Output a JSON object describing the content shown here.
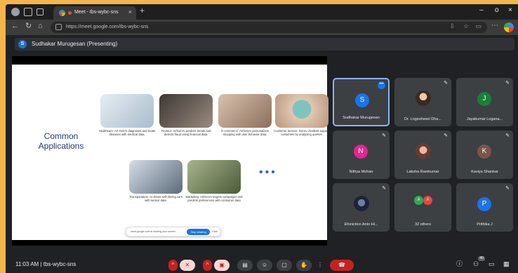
{
  "browser": {
    "tab_title": "Meet - tbs-wybc-sns",
    "url": "https://meet.google.com/tbs-wybc-sns",
    "tab_close": "×",
    "new_tab": "+",
    "minimize": "–",
    "maximize": "o",
    "close": "×"
  },
  "presenter": {
    "initial": "S",
    "label": "Sudhakar Murugesan (Presenting)"
  },
  "slide": {
    "title": "Common Applications",
    "cards": [
      {
        "id": "healthcare",
        "text": "Healthcare: AI/ GenAI diagnoses and treats diseases with medical data.",
        "color": "#c9d6e2"
      },
      {
        "id": "finance",
        "text": "Finance: AI/GenAI predicts trends and detects fraud using financial data.",
        "color": "#6f625a"
      },
      {
        "id": "ecommerce",
        "text": "E-commerce: AI/GenAI personalizes shopping with user behavior data.",
        "color": "#b89c86"
      },
      {
        "id": "customer-service",
        "text": "Customer Service: GenAI chatbots support customers by analyzing queries.",
        "color": "#8fb0b2"
      },
      {
        "id": "transportation",
        "text": "Transportation: AI drives self-driving cars with sensor data.",
        "color": "#8a98a8"
      },
      {
        "id": "marketing",
        "text": "Marketing: AI/GenAI targets campaigns and predicts preferences with consumer data",
        "color": "#76855f"
      }
    ],
    "more": "•••",
    "share_banner": {
      "text": "meet.google.com is sharing your screen.",
      "stop_label": "Stop sharing",
      "hide_label": "Hide"
    }
  },
  "participants": [
    {
      "name": "Sudhakar Murugesan",
      "initial": "S",
      "color": "#1a73e8",
      "kind": "avatar",
      "active": true
    },
    {
      "name": "Dr. Logeshwari Dha...",
      "initial": "",
      "color": "#c8a07a",
      "kind": "photo",
      "active": false
    },
    {
      "name": "Jayakumar Logana...",
      "initial": "J",
      "color": "#188038",
      "kind": "avatar",
      "active": false
    },
    {
      "name": "Nithya Mohan",
      "initial": "N",
      "color": "#e52592",
      "kind": "avatar",
      "active": false
    },
    {
      "name": "Laksha Ramkumar",
      "initial": "",
      "color": "#b07a6a",
      "kind": "photo",
      "active": false
    },
    {
      "name": "Kaviya Shankar",
      "initial": "K",
      "color": "#795548",
      "kind": "avatar",
      "active": false
    },
    {
      "name": "Efoniction Anto Hi...",
      "initial": "",
      "color": "#2a3a55",
      "kind": "photo",
      "active": false
    },
    {
      "name": "32 others",
      "initial": "A",
      "color": "#34a853",
      "kind": "others",
      "second_initial": "A",
      "second_color": "#e8453c",
      "active": false
    },
    {
      "name": "Prithika J",
      "initial": "P",
      "color": "#1a73e8",
      "kind": "avatar",
      "active": false
    }
  ],
  "bottom": {
    "time": "11:03 AM",
    "meeting_code": "tbs-wybc-sns",
    "participant_count": "40"
  },
  "icons": {
    "mic_off": "mic-off-icon",
    "camera_off": "camera-off-icon",
    "captions": "captions-icon",
    "emoji": "emoji-icon",
    "present": "present-icon",
    "raise_hand": "raise-hand-icon",
    "more": "more-options-icon",
    "leave": "leave-call-icon",
    "info": "info-icon",
    "people": "people-icon",
    "chat": "chat-icon",
    "activities": "activities-icon"
  }
}
